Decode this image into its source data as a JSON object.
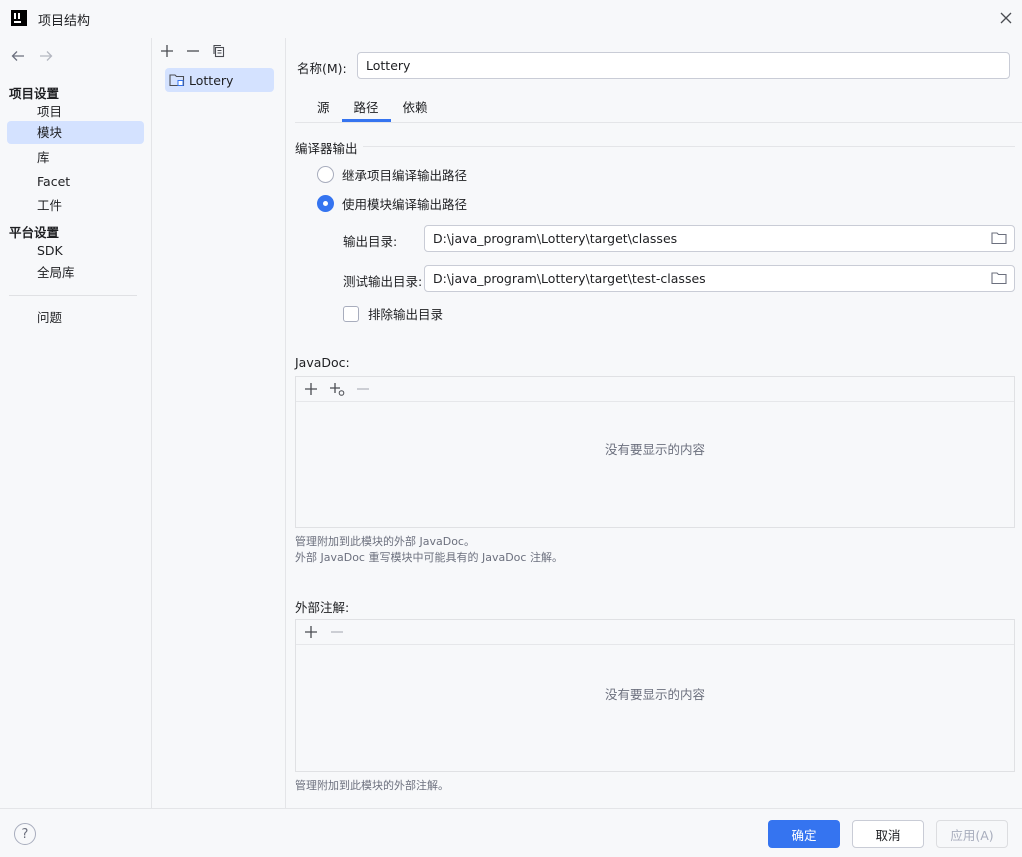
{
  "window": {
    "title": "项目结构"
  },
  "nav": {
    "project_settings_header": "项目设置",
    "platform_settings_header": "平台设置",
    "items": {
      "project": "项目",
      "modules": "模块",
      "libraries": "库",
      "facets": "Facet",
      "artifacts": "工件",
      "sdk": "SDK",
      "global_libraries": "全局库",
      "problems": "问题"
    },
    "selected": "模块"
  },
  "modules": {
    "items": [
      "Lottery"
    ],
    "selected": "Lottery"
  },
  "main": {
    "name_label": "名称(M):",
    "name_value": "Lottery",
    "tabs": [
      "源",
      "路径",
      "依赖"
    ],
    "active_tab": "路径",
    "compiler_output": {
      "title": "编译器输出",
      "option_inherit": "继承项目编译输出路径",
      "option_module": "使用模块编译输出路径",
      "selected_option": "使用模块编译输出路径",
      "output_dir_label": "输出目录:",
      "output_dir_value": "D:\\java_program\\Lottery\\target\\classes",
      "test_output_dir_label": "测试输出目录:",
      "test_output_dir_value": "D:\\java_program\\Lottery\\target\\test-classes",
      "exclude_label": "排除输出目录",
      "exclude_checked": false
    },
    "javadoc": {
      "title": "JavaDoc:",
      "empty_text": "没有要显示的内容",
      "hint_line1": "管理附加到此模块的外部 JavaDoc。",
      "hint_line2": "外部 JavaDoc 重写模块中可能具有的 JavaDoc 注解。"
    },
    "annotations": {
      "title": "外部注解:",
      "empty_text": "没有要显示的内容",
      "hint": "管理附加到此模块的外部注解。"
    }
  },
  "footer": {
    "help": "?",
    "ok": "确定",
    "cancel": "取消",
    "apply": "应用(A)"
  },
  "colors": {
    "accent": "#3574f0",
    "selection": "#d4e2ff",
    "background": "#f7f8fa"
  }
}
